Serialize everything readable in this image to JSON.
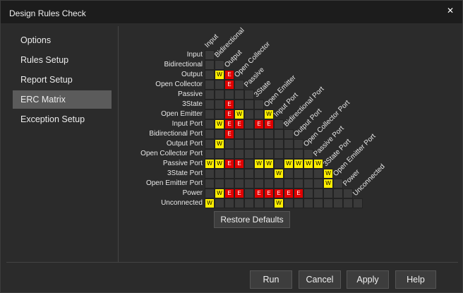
{
  "window": {
    "title": "Design Rules Check",
    "close_glyph": "✕"
  },
  "sidebar": {
    "items": [
      {
        "label": "Options"
      },
      {
        "label": "Rules Setup"
      },
      {
        "label": "Report Setup"
      },
      {
        "label": "ERC Matrix",
        "active": true
      },
      {
        "label": "Exception Setup"
      }
    ]
  },
  "matrix": {
    "labels": [
      "Input",
      "Bidirectional",
      "Output",
      "Open Collector",
      "Passive",
      "3State",
      "Open Emitter",
      "Input Port",
      "Bidirectional Port",
      "Output Port",
      "Open Collector Port",
      "Passive Port",
      "3State Port",
      "Open Emitter Port",
      "Power",
      "Unconnected"
    ],
    "rows": [
      [
        "-"
      ],
      [
        "-",
        "-"
      ],
      [
        "-",
        "W",
        "E"
      ],
      [
        "-",
        "-",
        "E",
        "-"
      ],
      [
        "-",
        "-",
        "-",
        "-",
        "-"
      ],
      [
        "-",
        "-",
        "E",
        "-",
        "-",
        "-"
      ],
      [
        "-",
        "-",
        "E",
        "W",
        "-",
        "-",
        "W"
      ],
      [
        "-",
        "W",
        "E",
        "E",
        "-",
        "E",
        "E",
        "-"
      ],
      [
        "-",
        "-",
        "E",
        "-",
        "-",
        "-",
        "-",
        "-",
        "-"
      ],
      [
        "-",
        "W",
        "-",
        "-",
        "-",
        "-",
        "-",
        "-",
        "-",
        "-"
      ],
      [
        "-",
        "-",
        "-",
        "-",
        "-",
        "-",
        "-",
        "-",
        "-",
        "-",
        "-"
      ],
      [
        "W",
        "W",
        "E",
        "E",
        "-",
        "W",
        "W",
        "-",
        "W",
        "W",
        "W",
        "W"
      ],
      [
        "-",
        "-",
        "-",
        "-",
        "-",
        "-",
        "-",
        "W",
        "-",
        "-",
        "-",
        "-",
        "W"
      ],
      [
        "-",
        "-",
        "-",
        "-",
        "-",
        "-",
        "-",
        "-",
        "-",
        "-",
        "-",
        "-",
        "W",
        "-"
      ],
      [
        "-",
        "W",
        "E",
        "E",
        "-",
        "E",
        "E",
        "E",
        "E",
        "E",
        "-",
        "-",
        "-",
        "-",
        "-"
      ],
      [
        "W",
        "-",
        "-",
        "-",
        "-",
        "-",
        "-",
        "W",
        "-",
        "-",
        "-",
        "-",
        "-",
        "-",
        "-",
        "-"
      ]
    ],
    "legend": {
      "W": "W",
      "E": "E"
    },
    "colors": {
      "warning": "#ffee00",
      "error": "#e00000",
      "empty": "#3a3a3a"
    }
  },
  "restore_defaults_label": "Restore Defaults",
  "footer": {
    "run_label": "Run",
    "cancel_label": "Cancel",
    "apply_label": "Apply",
    "help_label": "Help"
  }
}
